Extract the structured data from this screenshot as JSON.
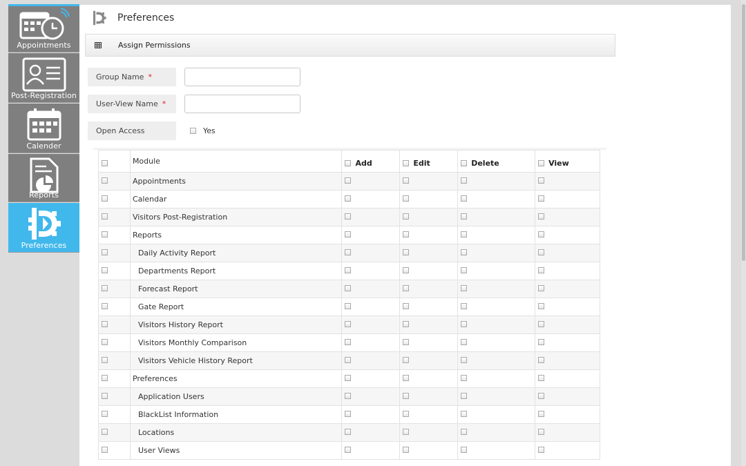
{
  "sidebar": {
    "items": [
      {
        "label": "Appointments",
        "icon": "calendar-clock-icon",
        "active": false
      },
      {
        "label": "Post-Registration",
        "icon": "id-card-icon",
        "active": false
      },
      {
        "label": "Calender",
        "icon": "calendar-icon",
        "active": false
      },
      {
        "label": "Reports",
        "icon": "report-icon",
        "active": false
      },
      {
        "label": "Preferences",
        "icon": "preferences-gear-icon",
        "active": true
      }
    ]
  },
  "header": {
    "title": "Preferences"
  },
  "subbar": {
    "label": "Assign Permissions"
  },
  "form": {
    "group_name_label": "Group Name",
    "user_view_name_label": "User-View Name",
    "required_mark": "*",
    "group_name_value": "",
    "user_view_name_value": "",
    "open_access_label": "Open Access",
    "open_access_option": "Yes"
  },
  "table": {
    "columns": {
      "module": "Module",
      "add": "Add",
      "edit": "Edit",
      "delete": "Delete",
      "view": "View"
    },
    "rows": [
      {
        "name": "Appointments",
        "sub": false
      },
      {
        "name": "Calendar",
        "sub": false
      },
      {
        "name": "Visitors Post-Registration",
        "sub": false
      },
      {
        "name": "Reports",
        "sub": false
      },
      {
        "name": "Daily Activity Report",
        "sub": true
      },
      {
        "name": "Departments Report",
        "sub": true
      },
      {
        "name": "Forecast Report",
        "sub": true
      },
      {
        "name": "Gate Report",
        "sub": true
      },
      {
        "name": "Visitors History Report",
        "sub": true
      },
      {
        "name": "Visitors Monthly Comparison",
        "sub": true
      },
      {
        "name": "Visitors Vehicle History Report",
        "sub": true
      },
      {
        "name": "Preferences",
        "sub": false
      },
      {
        "name": "Application Users",
        "sub": true
      },
      {
        "name": "BlackList Information",
        "sub": true
      },
      {
        "name": "Locations",
        "sub": true
      },
      {
        "name": "User Views",
        "sub": true
      }
    ]
  },
  "colors": {
    "accent": "#41b8eb",
    "nav_bg": "#7f7f7f",
    "required": "#dd2222"
  }
}
